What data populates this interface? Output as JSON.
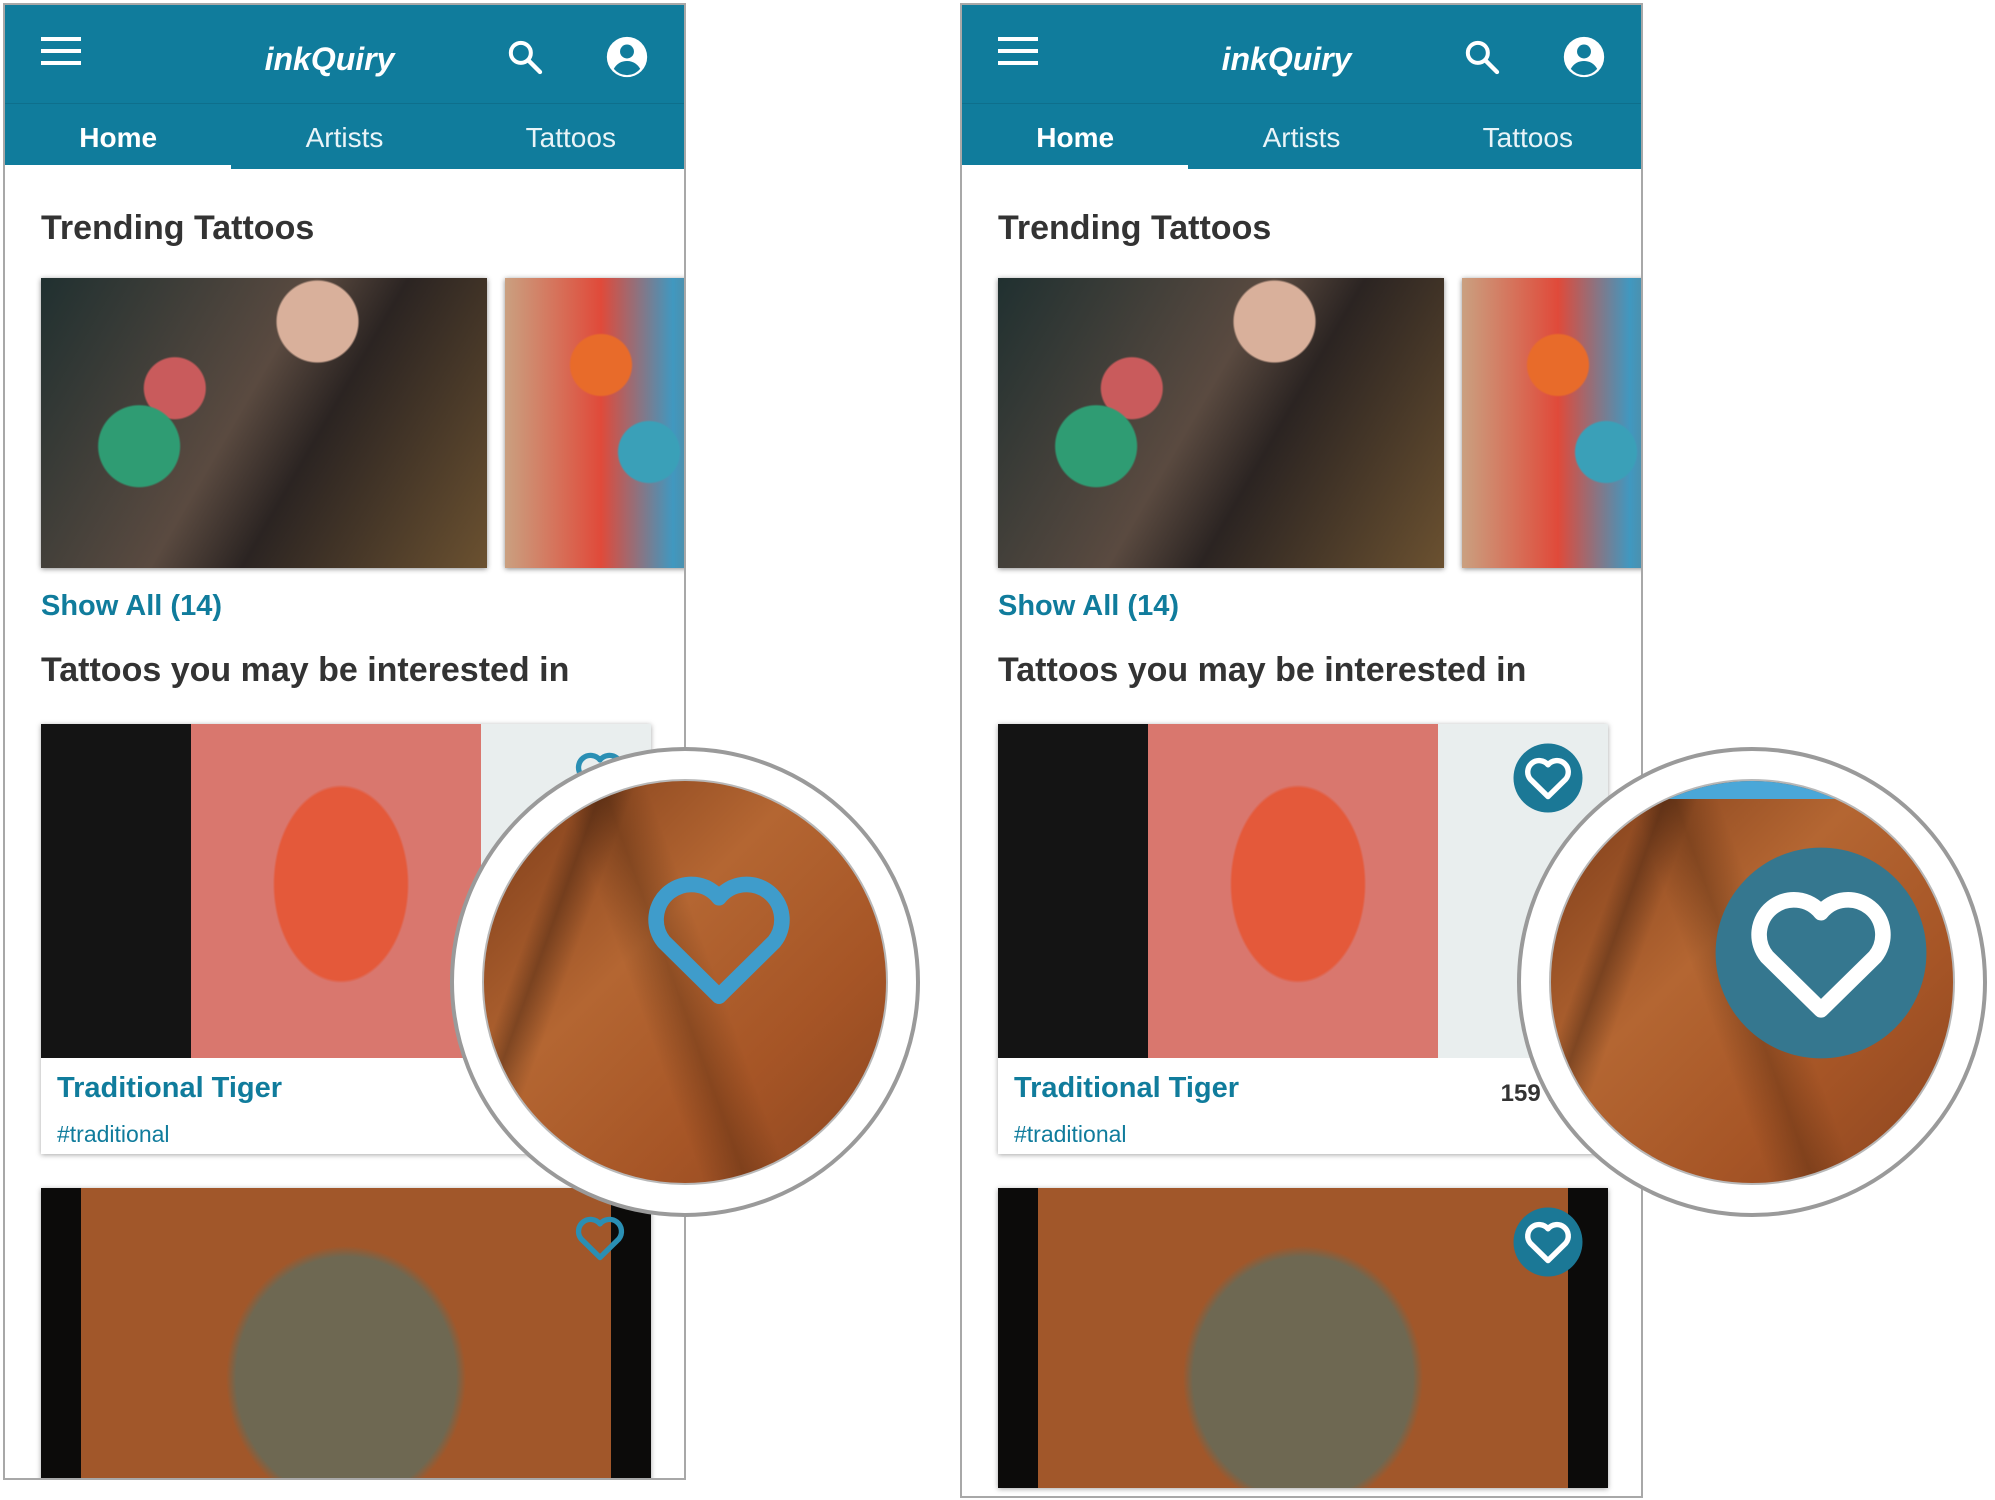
{
  "app": {
    "title": "inkQuiry",
    "tabs": [
      {
        "label": "Home",
        "active": true
      },
      {
        "label": "Artists",
        "active": false
      },
      {
        "label": "Tattoos",
        "active": false
      }
    ]
  },
  "sections": {
    "trending_title": "Trending Tattoos",
    "show_all": "Show All (14)",
    "interested_title": "Tattoos you may be interested in"
  },
  "cards": [
    {
      "title": "Traditional Tiger",
      "tag": "#traditional",
      "likes": "159 L"
    },
    {
      "title": "",
      "tag": "",
      "likes": ""
    }
  ],
  "icons": {
    "menu": "menu-icon",
    "search": "search-icon",
    "account": "account-icon",
    "favorite_outline": "heart-outline-icon",
    "favorite_filled": "heart-filled-icon"
  },
  "colors": {
    "primary": "#107c9c",
    "heart_outline": "#2a8fb4",
    "heart_filled_bg": "#1b7896",
    "text_dark": "#333333"
  }
}
